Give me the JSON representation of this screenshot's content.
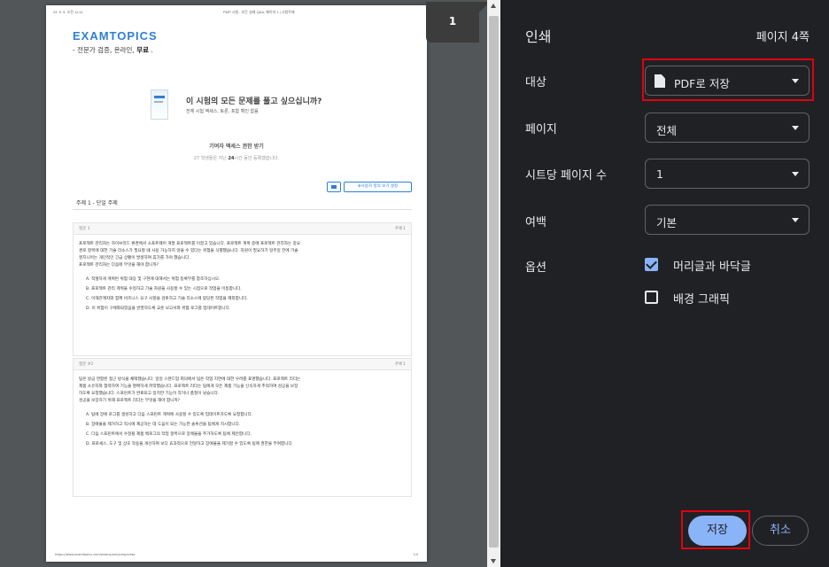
{
  "preview": {
    "header_date": "24. 5. 5. 오전 11:11",
    "header_title": "PMP 시험 - 모든 실제 Q&A, 페이지 1 | 시험주제",
    "logo": "EXAMTOPICS",
    "tagline": "- 전문가 검증, 온라인,",
    "tagline_bold": "무료",
    "tagline_end": ".",
    "promo_title": "이 시험의 모든 문제를 풀고 싶으십니까?",
    "promo_subtitle": "전체 시험 액세스, 토론, 포함 확인 없음",
    "promo_cta": "기여자 액세스 권한 받기",
    "promo_note_prefix": "27 학생들은 지난",
    "promo_note_hours": "24",
    "promo_note_suffix": "시간 동안 등록했습니다.",
    "discussion_button": "⊕사용자 정의 보기 설정",
    "topic_bar": "주제 1 - 단일 주제",
    "footer_url": "https://www.examtopics.com/exams/pmi/pmp/view/",
    "footer_page": "1/4",
    "questions": [
      {
        "number": "질문 1",
        "topic": "주제 1",
        "lines": [
          "프로젝트 관리자는 하이브리드 환경에서 소프트웨어 개발 프로젝트를 이끌고 있습니다. 프로젝트 계획 중에 프로젝트 관리자는 중요",
          "경로 항목에 대한 기술 리소스가 필요할 때 사용 가능하지 않을 수 있다는 위험을 식별했습니다. 자원이 필요하기 일주일 전에 기술",
          "엔지니어는 개인적인 긴급 상황이 발생하여 휴가를 가야 했습니다.",
          "프로젝트 관리자는 다음에 무엇을 해야 합니까?"
        ],
        "options": [
          "A. 적절하게 계획된 위험 대응 및 구현에 대해서는 위험 등록부를 참조하십시오.",
          "B. 프로젝트 관리 계획을 수정하고 기술 자원을 사용할 수 있는 시점으로 작업을 이동합니다.",
          "C. 이해관계자와 함께 비즈니스 요구 사항을 검토하고 기술 리소스에 맞당된 작업을 제외합니다.",
          "D. 이 위험이 구체화되었음을 반영하도록 교훈 보고서와 위험 로그를 업데이트합니다."
        ]
      },
      {
        "number": "질문 #2",
        "topic": "주제 1",
        "lines": [
          "팀은 방금 연합된 접근 방식을 채택했습니다. 일일 스탠드업 회의에서 팀은 작업 지연에 대한 우려를 표명했습니다. 프로젝트 리더는",
          "제품 소유자와 협력하여 기능을 명확하게 파악했습니다. 프로젝트 리더는 팀에게 모든 제품 기능을 신속하게 추적하여 성공을 보장",
          "하도록 요청했습니다. 스프린트가 완료되고 일치만 기능이 작거나 품질이 낮습니다.",
          "성공을 보장하기 위해 프로젝트 리더는 무엇을 해야 합니까?"
        ],
        "options": [
          "A. 팀에 장애 로그를 생성하고 다음 스프린트 계획에 사용할 수 있도록 업데이트하도록 요청합니다.",
          "B. 장애물을 제거하고 적시에 제공하는 데 도움이 되는 가능한 솔루션을 팀에게 지시합니다.",
          "C. 다음 스프린트에서 수정될 제품 백로그의 작업 항목으로 장애물을 추가하도록 팀에 제안합니다.",
          "D. 프로세스, 도구 및 상호 작용을 개선하여 보다 효과적으로 전달하고 장애물을 제거할 수 있도록 팀에 권한을 부여합니다."
        ]
      }
    ]
  },
  "page_indicator": "1",
  "settings": {
    "title": "인쇄",
    "page_count": "페이지 4쪽",
    "destination_label": "대상",
    "destination_value": "PDF로 저장",
    "pages_label": "페이지",
    "pages_value": "전체",
    "pages_per_sheet_label": "시트당 페이지 수",
    "pages_per_sheet_value": "1",
    "margins_label": "여백",
    "margins_value": "기본",
    "options_label": "옵션",
    "option_headers_footers": "머리글과 바닥글",
    "option_headers_footers_checked": true,
    "option_background_graphics": "배경 그래픽",
    "option_background_graphics_checked": false,
    "save_button": "저장",
    "cancel_button": "취소"
  },
  "colors": {
    "panel_bg": "#202124",
    "accent_blue": "#8ab4f8",
    "highlight_red": "#e0000f",
    "preview_bg": "#525659"
  }
}
